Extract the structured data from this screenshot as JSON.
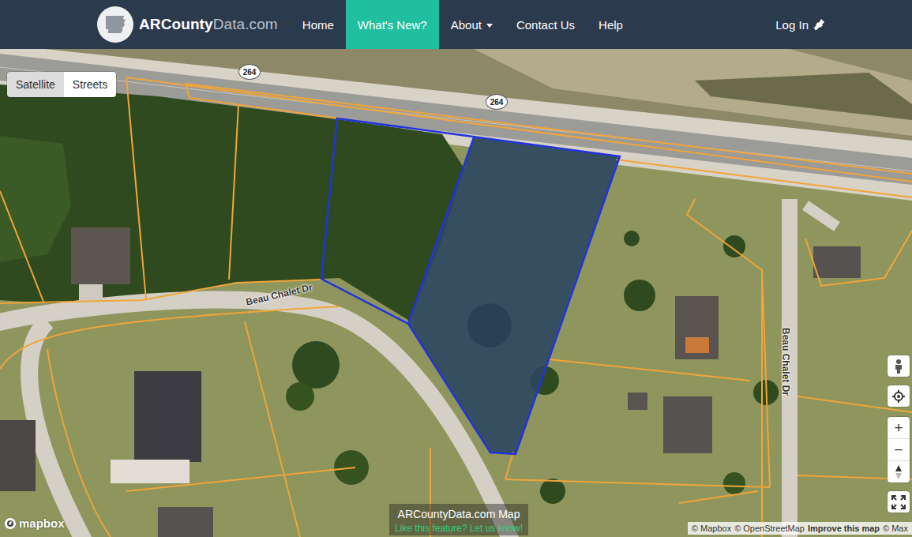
{
  "header": {
    "brand": [
      "ARCounty",
      "Data.com"
    ],
    "nav": [
      {
        "label": "Home",
        "selected": false,
        "kind": "link"
      },
      {
        "label": "What's New?",
        "selected": true,
        "kind": "link"
      },
      {
        "label": "About",
        "selected": false,
        "kind": "dropdown"
      },
      {
        "label": "Contact Us",
        "selected": false,
        "kind": "link"
      },
      {
        "label": "Help",
        "selected": false,
        "kind": "link"
      }
    ],
    "login": "Log In"
  },
  "map": {
    "layers": [
      {
        "label": "Satellite",
        "selected": true
      },
      {
        "label": "Streets",
        "selected": false
      }
    ],
    "labels": [
      {
        "text": "264",
        "kind": "shield"
      },
      {
        "text": "264",
        "kind": "shield"
      },
      {
        "text": "Beau Chalet Dr",
        "kind": "street"
      },
      {
        "text": "Beau Chalet Dr",
        "kind": "street"
      }
    ],
    "zoom": {
      "in": "+",
      "out": "−"
    },
    "caption": {
      "title": "ARCountyData.com Map",
      "link": "Like this feature? Let us know!"
    },
    "logo": "mapbox",
    "attribution": [
      "© Mapbox",
      "© OpenStreetMap",
      "Improve this map",
      "© Max"
    ]
  }
}
